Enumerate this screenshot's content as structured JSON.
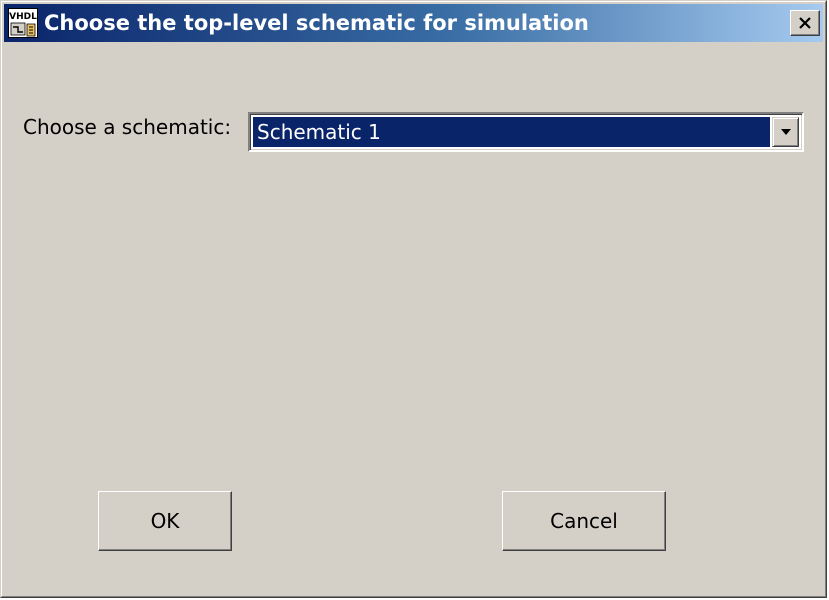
{
  "window": {
    "title": "Choose the top-level schematic for simulation",
    "app_icon": "vhdl-app-icon",
    "close_icon": "close-icon"
  },
  "form": {
    "label": "Choose a schematic:",
    "schematic_select": {
      "selected": "Schematic 1",
      "arrow_icon": "chevron-down-icon"
    }
  },
  "buttons": {
    "ok_label": "OK",
    "cancel_label": "Cancel"
  },
  "colors": {
    "title_bar_start": "#0a246a",
    "title_bar_end": "#a6caf0",
    "dialog_face": "#d4d0c8",
    "selection_highlight": "#0a246a"
  }
}
